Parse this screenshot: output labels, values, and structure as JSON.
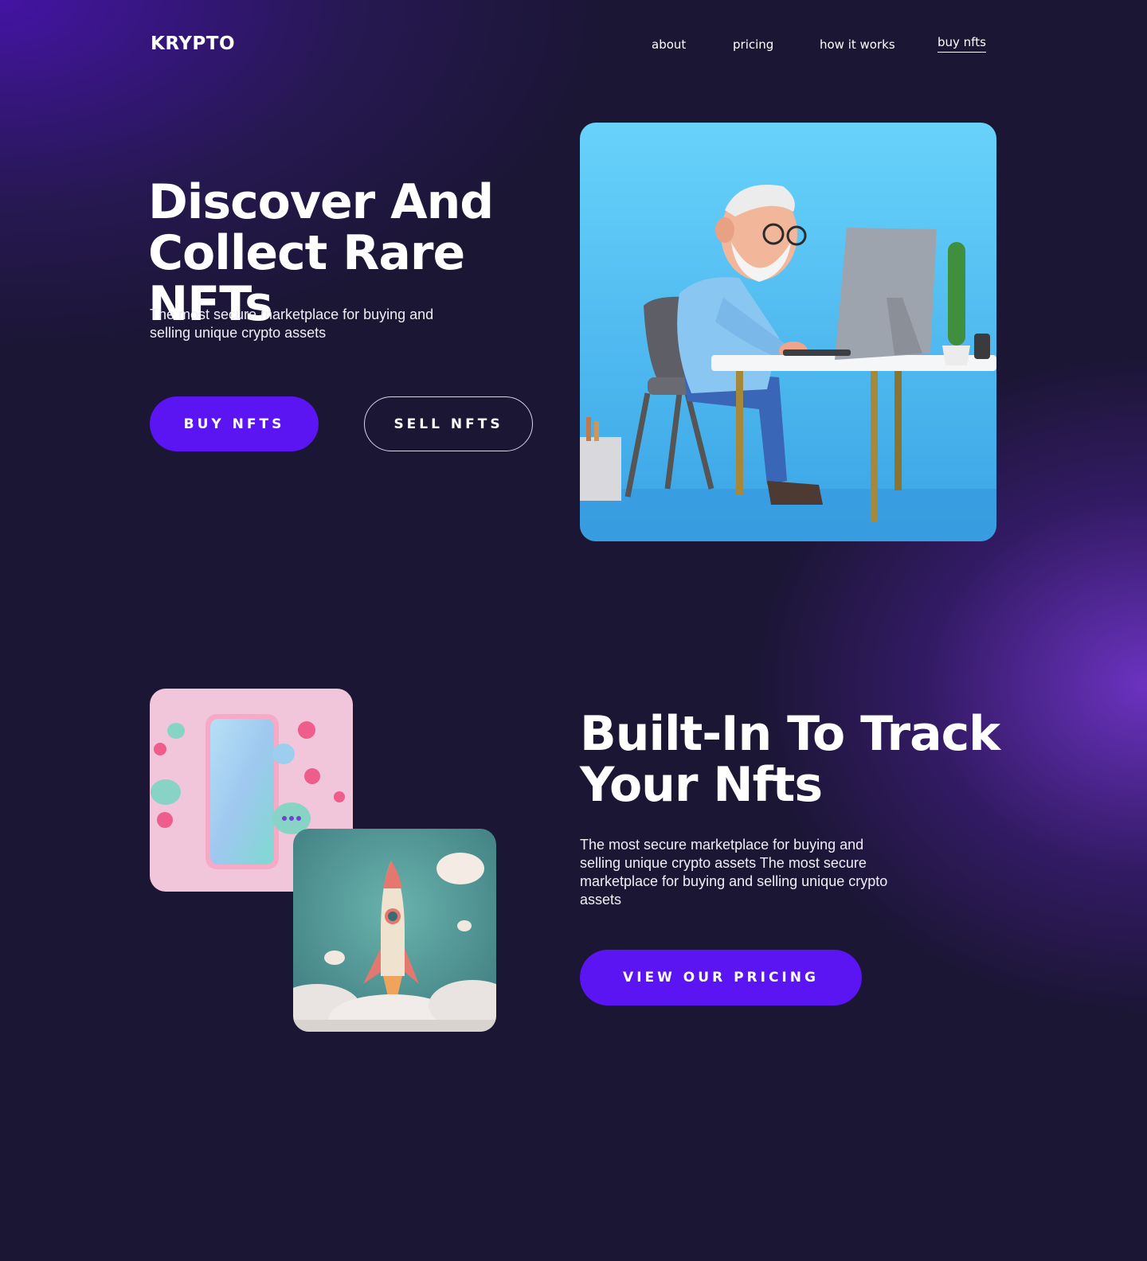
{
  "header": {
    "logo": "KRYPTO",
    "nav": [
      {
        "label": "about"
      },
      {
        "label": "pricing"
      },
      {
        "label": "how it works"
      },
      {
        "label": "buy nfts"
      }
    ]
  },
  "hero": {
    "title_line1": "Discover And",
    "title_line2": "Collect Rare NFTs",
    "subtitle_line1": "The most secure marketplace  for buying and",
    "subtitle_line2": "selling unique crypto assets",
    "buy_label": "BUY NFTS",
    "sell_label": "SELL NFTS"
  },
  "features": {
    "title_line1": "Built-In To Track",
    "title_line2": "Your Nfts",
    "body_line1": "The most secure marketplace  for buying and",
    "body_line2": "selling unique crypto assets The most secure",
    "body_line3": "marketplace  for buying and selling unique crypto",
    "body_line4": "assets",
    "pricing_label": "VIEW OUR PRICING"
  },
  "colors": {
    "background": "#1b1634",
    "accent": "#5b14f2",
    "hero_image_bg": "#5cc6f6",
    "phone_card_bg": "#f2c6da",
    "rocket_card_bg": "#4f9e9e"
  }
}
